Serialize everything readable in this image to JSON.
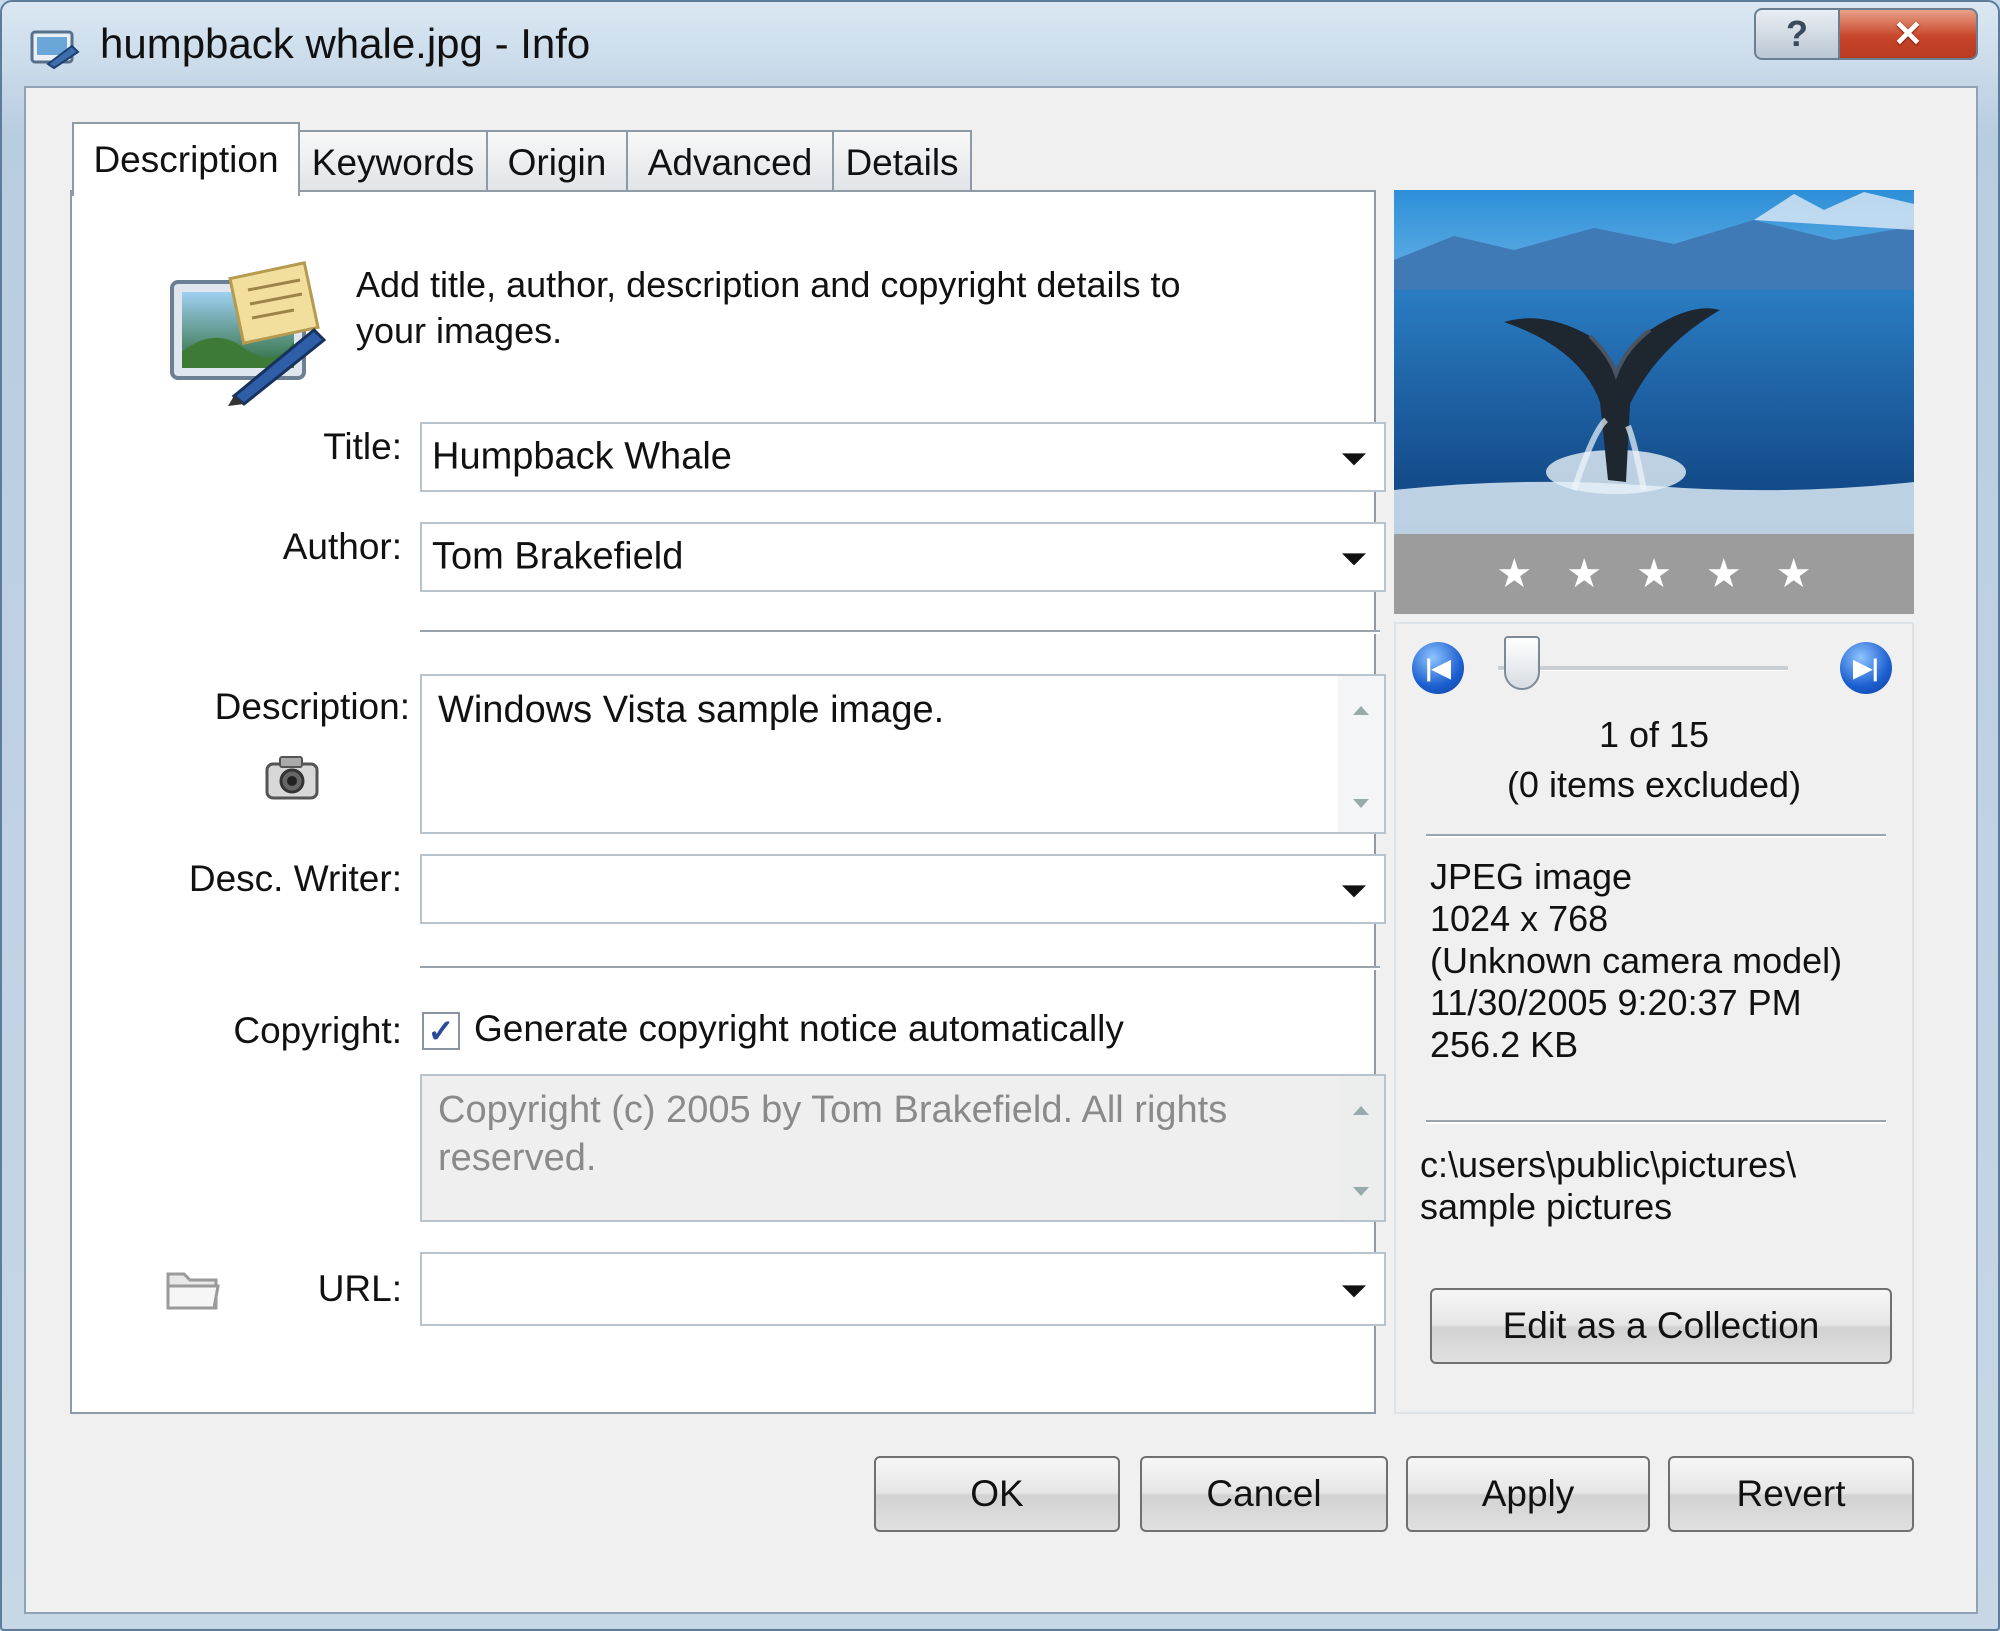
{
  "window": {
    "title": "humpback whale.jpg - Info",
    "help_glyph": "?",
    "close_glyph": "✕"
  },
  "tabs": [
    {
      "label": "Description"
    },
    {
      "label": "Keywords"
    },
    {
      "label": "Origin"
    },
    {
      "label": "Advanced"
    },
    {
      "label": "Details"
    }
  ],
  "description_tab": {
    "intro": "Add title, author, description and copyright details to your images.",
    "title_label": "Title:",
    "title_value": "Humpback Whale",
    "author_label": "Author:",
    "author_value": "Tom Brakefield",
    "description_label": "Description:",
    "description_value": "Windows Vista sample image.",
    "desc_writer_label": "Desc. Writer:",
    "desc_writer_value": "",
    "copyright_label": "Copyright:",
    "copyright_checkbox_label": "Generate copyright notice automatically",
    "copyright_checked": true,
    "copyright_text": "Copyright (c) 2005 by Tom Brakefield. All rights reserved.",
    "url_label": "URL:",
    "url_value": ""
  },
  "preview": {
    "rating_stars": 5,
    "position": "1 of 15",
    "excluded": "(0 items excluded)",
    "slider_position": 1,
    "slider_total": 15,
    "info_lines": [
      "JPEG image",
      "1024 x 768",
      "(Unknown camera model)",
      "11/30/2005 9:20:37 PM",
      "256.2 KB"
    ],
    "path_lines": [
      "c:\\users\\public\\pictures\\",
      "sample pictures"
    ],
    "edit_collection_label": "Edit as a Collection"
  },
  "buttons": {
    "ok": "OK",
    "cancel": "Cancel",
    "apply": "Apply",
    "revert": "Revert"
  },
  "icons": {
    "window": "picture-info-icon",
    "intro": "picture-edit-icon",
    "description": "camera-icon",
    "url": "folder-link-icon",
    "prev": "previous-icon",
    "next": "next-icon"
  }
}
